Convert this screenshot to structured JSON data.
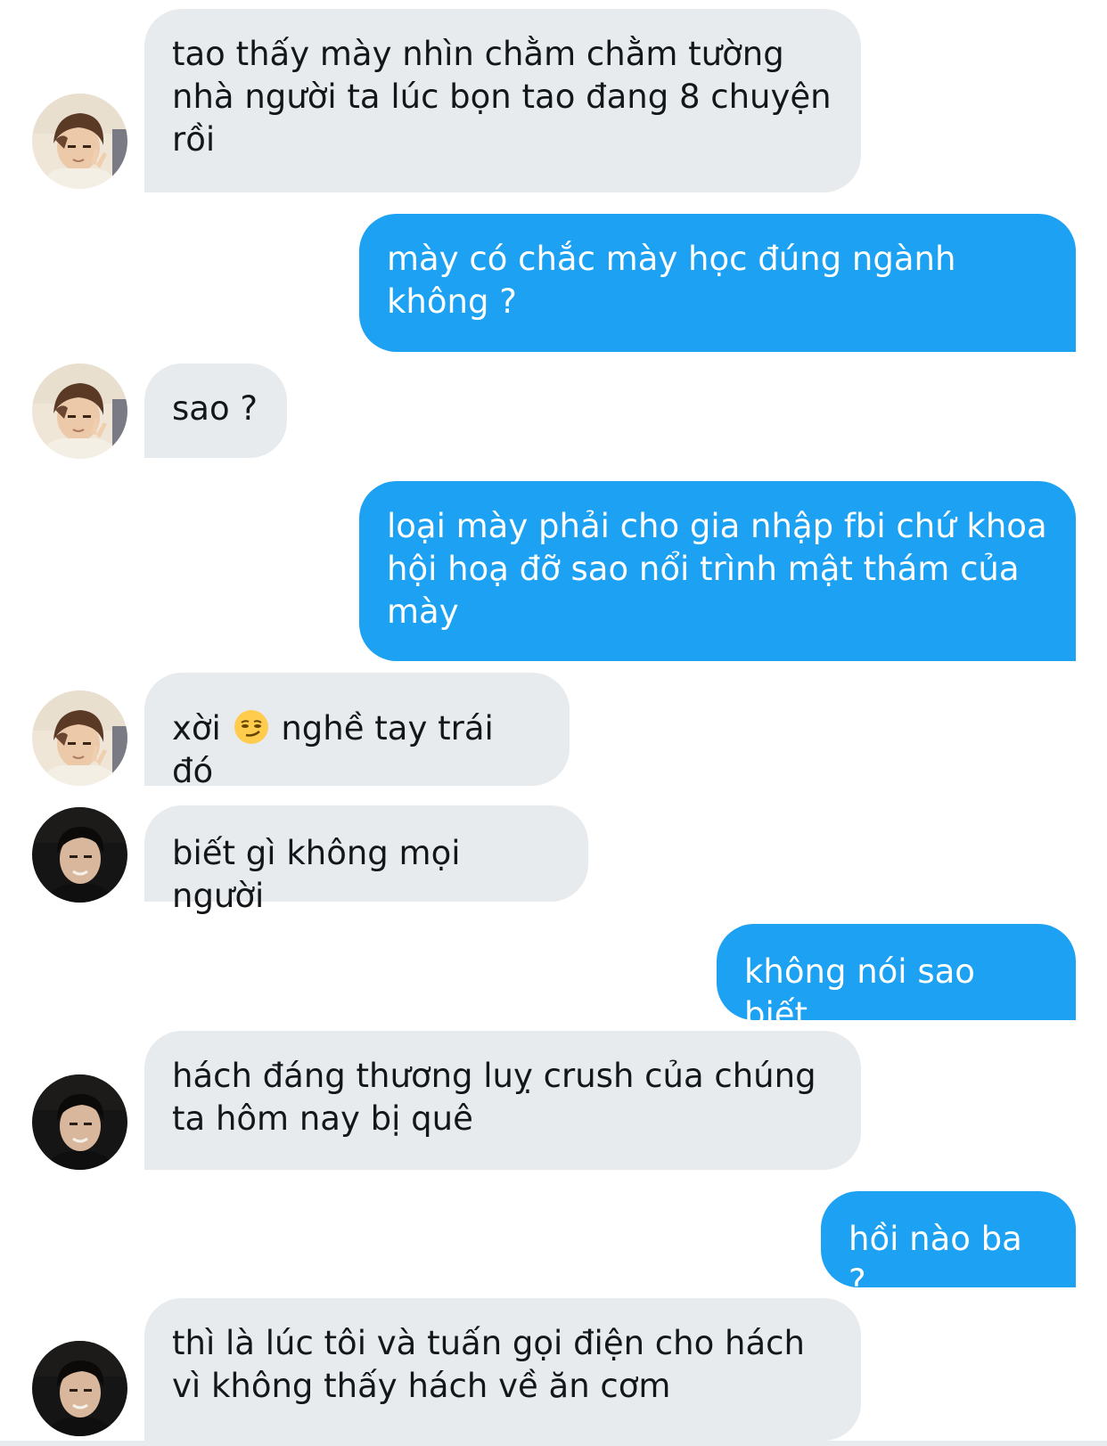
{
  "messages": [
    {
      "sender": "other",
      "avatar": "avatar-v",
      "text": "tao thấy mày nhìn chằm chằm tường nhà người ta lúc bọn tao đang 8 chuyện rồi"
    },
    {
      "sender": "me",
      "text": "mày có chắc mày học đúng ngành không ?"
    },
    {
      "sender": "other",
      "avatar": "avatar-v",
      "text": "sao ?"
    },
    {
      "sender": "me",
      "text": "loại mày phải cho gia nhập fbi chứ khoa hội hoạ đỡ sao nổi trình mật thám của mày"
    },
    {
      "sender": "other",
      "avatar": "avatar-v",
      "text_before_emoji": "xời",
      "emoji": "smirking-face-emoji",
      "text_after_emoji": "nghề tay trái đó"
    },
    {
      "sender": "other",
      "avatar": "avatar-m",
      "text": "biết gì không mọi người"
    },
    {
      "sender": "me",
      "text": "không nói sao biết"
    },
    {
      "sender": "other",
      "avatar": "avatar-m",
      "text": "hách đáng thương luỵ crush của chúng ta hôm nay bị quê"
    },
    {
      "sender": "me",
      "text": "hồi nào ba ?"
    },
    {
      "sender": "other",
      "avatar": "avatar-m",
      "text": "thì là lúc tôi và tuấn gọi điện cho hách vì không thấy hách về ăn cơm"
    }
  ],
  "colors": {
    "incoming_bubble": "#e8ebee",
    "incoming_text": "#14171a",
    "outgoing_bubble": "#1da1f2",
    "outgoing_text": "#ffffff"
  }
}
